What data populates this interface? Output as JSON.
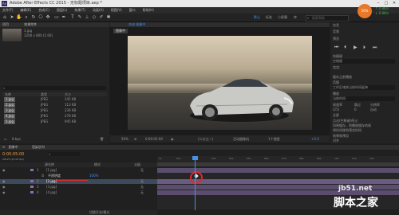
{
  "titlebar": {
    "app_badge": "Ae",
    "title": "Adobe After Effects CC 2015 - 无标题项目.aep *"
  },
  "menu": [
    "文件(F)",
    "编辑(E)",
    "合成(C)",
    "图层(L)",
    "效果(T)",
    "动画(A)",
    "视图(V)",
    "窗口",
    "帮助(H)"
  ],
  "workspace": {
    "items": [
      "默认",
      "标准",
      "小屏幕",
      "库"
    ],
    "active": "默认",
    "search_placeholder": "搜索帮助"
  },
  "project": {
    "tab": "项目",
    "preview_name": "3.jpg",
    "preview_info": "1200 x 800 (1.00)",
    "columns": [
      "名称",
      "类型",
      "大小"
    ],
    "items": [
      {
        "name": "1.jpg",
        "type": "JPEG",
        "size": "245 KB"
      },
      {
        "name": "2.jpg",
        "type": "JPEG",
        "size": "113 KB"
      },
      {
        "name": "3.jpg",
        "type": "JPEG",
        "size": "236 KB"
      },
      {
        "name": "4.jpg",
        "type": "JPEG",
        "size": "278 KB"
      },
      {
        "name": "5.jpg",
        "type": "JPEG",
        "size": "945 KB"
      }
    ],
    "footer": "8 bpc"
  },
  "effects_tab": "效果控件",
  "comp_viewer": {
    "tab": "合成 图像中",
    "flow_tab": "图像中",
    "zoom": "50%",
    "timecode": "0:00:05:00",
    "resolution": "(二分之一)",
    "camera": "活动摄像机",
    "views": "1个视图",
    "exposure": "+0.0"
  },
  "right_panels": {
    "info": "信息",
    "audio": "音频",
    "preview": "预览",
    "preview_shortcut_label": "快捷键",
    "preview_shortcut": "空格键",
    "include": "包含:",
    "cache": "缓存之前播放",
    "range_label": "范围",
    "range": "工作区域按当前时间延伸",
    "play_from_label": "播放",
    "play_from": "当前时间",
    "frame_rate_label": "帧速率",
    "frame_rate": "(25)",
    "skip_label": "跳过",
    "skip": "0",
    "resolution_label": "分辨率",
    "resolution": "自动",
    "fullscreen": "全屏",
    "stop_label": "点击(空格键)停止:",
    "opt1": "如果缓存，则播放缓存的帧",
    "opt2": "将时间移到预览时间",
    "effects": "效果和预设",
    "align": "对齐",
    "library": "库"
  },
  "status_badges": [
    "↑ 0.8K/s",
    "↓ 0.8K/s"
  ],
  "status_percent": "50%",
  "timeline": {
    "tab": "图像中",
    "render_tab": "渲染队列",
    "timecode": "0:00:05:00",
    "frames": "00125 (25.00 fps)",
    "col_source": "源名称",
    "col_mode": "模式",
    "col_parent": "父级",
    "ruler": [
      "0s",
      "01s",
      "02s",
      "03s",
      "04s",
      "05s",
      "06s",
      "07s",
      "08s",
      "09s",
      "10s",
      "11s",
      "12s"
    ],
    "layers": [
      {
        "num": "1",
        "name": "[1.jpg]",
        "parent": "无"
      },
      {
        "num": "",
        "name": "不透明度",
        "parent": ""
      },
      {
        "num": "2",
        "name": "[2.jpg]",
        "parent": "无"
      },
      {
        "num": "3",
        "name": "[3.jpg]",
        "parent": "无"
      },
      {
        "num": "4",
        "name": "[4.jpg]",
        "parent": "无"
      }
    ],
    "opacity_value": "100%",
    "footer": "切换开关/模式"
  },
  "watermark": {
    "site": "jb51.net",
    "brand": "脚本之家"
  },
  "colors": {
    "accent_blue": "#4a8ee6",
    "accent_orange": "#e89a3c",
    "highlight_red": "#e02a2a",
    "layer_purple": "#8c6fb0"
  }
}
